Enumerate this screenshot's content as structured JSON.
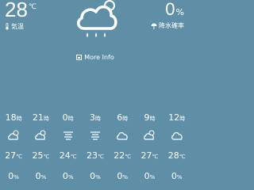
{
  "current": {
    "temperature": "28",
    "temperature_unit": "℃",
    "temperature_label": "気温",
    "condition_icon": "cloud-sun-rain-icon",
    "precip_value": "0",
    "precip_unit": "%",
    "precip_label": "降水確率"
  },
  "more_info_label": "More Info",
  "hourly": [
    {
      "hour": "18",
      "suffix": "時",
      "icon": "cloud-sun-icon",
      "temp": "27",
      "temp_unit": "℃",
      "precip": "0",
      "precip_unit": "%"
    },
    {
      "hour": "21",
      "suffix": "時",
      "icon": "cloud-sun-icon",
      "temp": "25",
      "temp_unit": "℃",
      "precip": "0",
      "precip_unit": "%"
    },
    {
      "hour": "0",
      "suffix": "時",
      "icon": "fog-icon",
      "temp": "24",
      "temp_unit": "℃",
      "precip": "0",
      "precip_unit": "%"
    },
    {
      "hour": "3",
      "suffix": "時",
      "icon": "fog-icon",
      "temp": "23",
      "temp_unit": "℃",
      "precip": "0",
      "precip_unit": "%"
    },
    {
      "hour": "6",
      "suffix": "時",
      "icon": "cloud-icon",
      "temp": "22",
      "temp_unit": "℃",
      "precip": "0",
      "precip_unit": "%"
    },
    {
      "hour": "9",
      "suffix": "時",
      "icon": "cloud-sun-icon",
      "temp": "27",
      "temp_unit": "℃",
      "precip": "0",
      "precip_unit": "%"
    },
    {
      "hour": "12",
      "suffix": "時",
      "icon": "cloud-icon",
      "temp": "28",
      "temp_unit": "℃",
      "precip": "0",
      "precip_unit": "%"
    }
  ]
}
